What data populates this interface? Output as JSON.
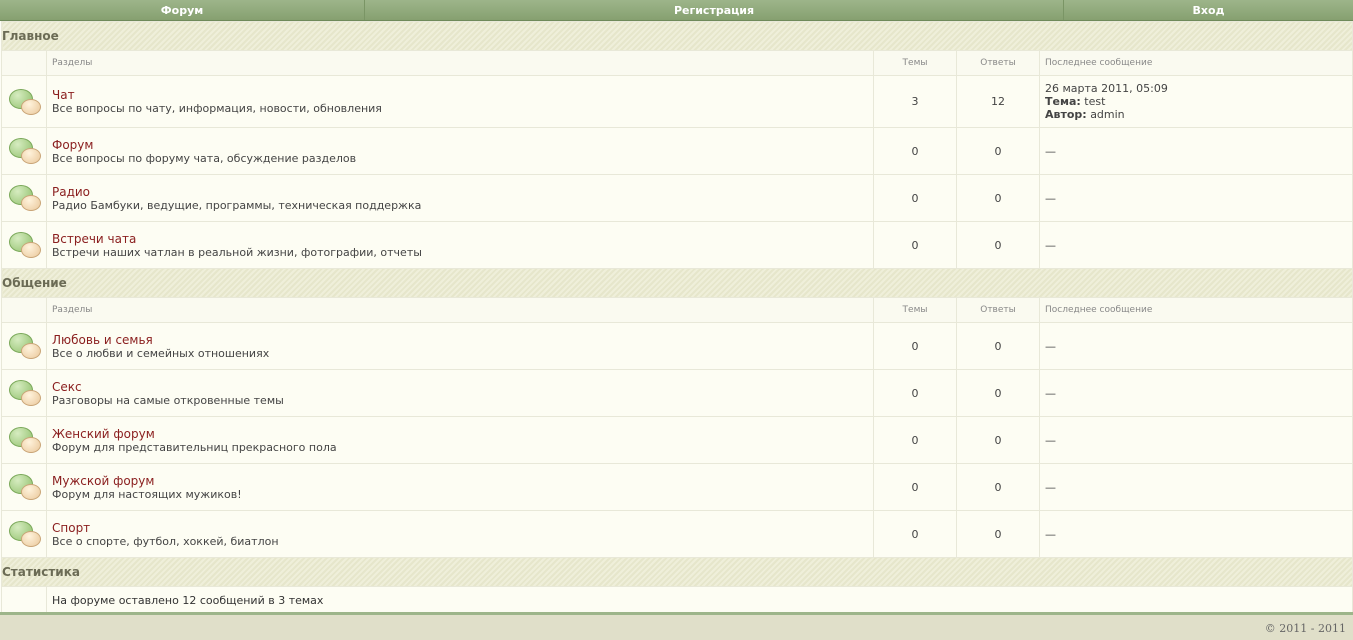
{
  "nav": {
    "forum": "Форум",
    "register": "Регистрация",
    "login": "Вход"
  },
  "headers": {
    "sections": "Разделы",
    "topics": "Темы",
    "replies": "Ответы",
    "last_post": "Последнее сообщение"
  },
  "groups": [
    {
      "title": "Главное",
      "forums": [
        {
          "title": "Чат",
          "desc": "Все вопросы по чату, информация, новости, обновления",
          "topics": "3",
          "replies": "12",
          "last": {
            "date": "26 марта 2011, 05:09",
            "topic_label": "Тема:",
            "topic": "test",
            "author_label": "Автор:",
            "author": "admin"
          }
        },
        {
          "title": "Форум",
          "desc": "Все вопросы по форуму чата, обсуждение разделов",
          "topics": "0",
          "replies": "0",
          "last_empty": "—"
        },
        {
          "title": "Радио",
          "desc": "Радио Бамбуки, ведущие, программы, техническая поддержка",
          "topics": "0",
          "replies": "0",
          "last_empty": "—"
        },
        {
          "title": "Встречи чата",
          "desc": "Встречи наших чатлан в реальной жизни, фотографии, отчеты",
          "topics": "0",
          "replies": "0",
          "last_empty": "—"
        }
      ]
    },
    {
      "title": "Общение",
      "forums": [
        {
          "title": "Любовь и семья",
          "desc": "Все о любви и семейных отношениях",
          "topics": "0",
          "replies": "0",
          "last_empty": "—"
        },
        {
          "title": "Секс",
          "desc": "Разговоры на самые откровенные темы",
          "topics": "0",
          "replies": "0",
          "last_empty": "—"
        },
        {
          "title": "Женский форум",
          "desc": "Форум для представительниц прекрасного пола",
          "topics": "0",
          "replies": "0",
          "last_empty": "—"
        },
        {
          "title": "Мужской форум",
          "desc": "Форум для настоящих мужиков!",
          "topics": "0",
          "replies": "0",
          "last_empty": "—"
        },
        {
          "title": "Спорт",
          "desc": "Все о спорте, футбол, хоккей, биатлон",
          "topics": "0",
          "replies": "0",
          "last_empty": "—"
        }
      ]
    }
  ],
  "stats": {
    "title": "Статистика",
    "text": "На форуме оставлено 12 сообщений в 3 темах"
  },
  "footer": {
    "copyright": "© 2011 - 2011"
  },
  "colors": {
    "nav_bg": "#94ad7f",
    "link": "#8a1e1e",
    "section_bg": "#e9e9d1"
  },
  "icons": {
    "forum": "speech-bubbles-icon"
  }
}
